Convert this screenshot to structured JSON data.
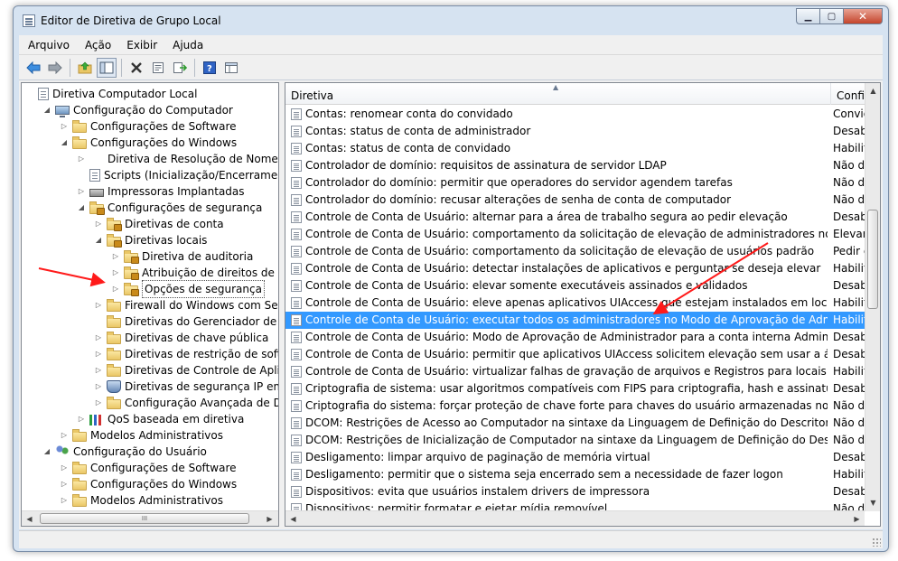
{
  "window": {
    "title": "Editor de Diretiva de Grupo Local",
    "controls": {
      "minimize": "▁",
      "maximize": "▢",
      "close": "✕"
    }
  },
  "menu": [
    "Arquivo",
    "Ação",
    "Exibir",
    "Ajuda"
  ],
  "tree": {
    "items": [
      {
        "label": "Diretiva Computador Local",
        "icon": "document-icon",
        "level": 0,
        "twisty": ""
      },
      {
        "label": "Configuração do Computador",
        "icon": "computer-icon",
        "level": 1,
        "twisty": "◢"
      },
      {
        "label": "Configurações de Software",
        "icon": "folder-icon",
        "level": 2,
        "twisty": "▷"
      },
      {
        "label": "Configurações do Windows",
        "icon": "folder-icon",
        "level": 2,
        "twisty": "◢"
      },
      {
        "label": "Diretiva de Resolução de Nome",
        "icon": "none",
        "level": 3,
        "twisty": "▷"
      },
      {
        "label": "Scripts (Inicialização/Encerramento)",
        "icon": "document-icon",
        "level": 3,
        "twisty": ""
      },
      {
        "label": "Impressoras Implantadas",
        "icon": "printer-icon",
        "level": 3,
        "twisty": "▷"
      },
      {
        "label": "Configurações de segurança",
        "icon": "lock-folder-icon",
        "level": 3,
        "twisty": "◢"
      },
      {
        "label": "Diretivas de conta",
        "icon": "lock-folder-icon",
        "level": 4,
        "twisty": "▷"
      },
      {
        "label": "Diretivas locais",
        "icon": "lock-folder-icon",
        "level": 4,
        "twisty": "◢"
      },
      {
        "label": "Diretiva de auditoria",
        "icon": "lock-folder-icon",
        "level": 5,
        "twisty": "▷"
      },
      {
        "label": "Atribuição de direitos de usuário",
        "icon": "lock-folder-icon",
        "level": 5,
        "twisty": "▷"
      },
      {
        "label": "Opções de segurança",
        "icon": "lock-folder-icon",
        "level": 5,
        "twisty": "▷",
        "selected": true
      },
      {
        "label": "Firewall do Windows com Segurança Avançada",
        "icon": "folder-icon",
        "level": 4,
        "twisty": "▷"
      },
      {
        "label": "Diretivas do Gerenciador de Listas de Redes",
        "icon": "folder-icon",
        "level": 4,
        "twisty": ""
      },
      {
        "label": "Diretivas de chave pública",
        "icon": "folder-icon",
        "level": 4,
        "twisty": "▷"
      },
      {
        "label": "Diretivas de restrição de software",
        "icon": "folder-icon",
        "level": 4,
        "twisty": "▷"
      },
      {
        "label": "Diretivas de Controle de Aplicativos",
        "icon": "folder-icon",
        "level": 4,
        "twisty": "▷"
      },
      {
        "label": "Diretivas de segurança IP em Computador Local",
        "icon": "shield-computer-icon",
        "level": 4,
        "twisty": "▷"
      },
      {
        "label": "Configuração Avançada de Diretiva de Auditoria",
        "icon": "folder-icon",
        "level": 4,
        "twisty": "▷"
      },
      {
        "label": "QoS baseada em diretiva",
        "icon": "qos-chart-icon",
        "level": 3,
        "twisty": "▷"
      },
      {
        "label": "Modelos Administrativos",
        "icon": "folder-icon",
        "level": 2,
        "twisty": "▷"
      },
      {
        "label": "Configuração do Usuário",
        "icon": "users-icon",
        "level": 1,
        "twisty": "◢"
      },
      {
        "label": "Configurações de Software",
        "icon": "folder-icon",
        "level": 2,
        "twisty": "▷"
      },
      {
        "label": "Configurações do Windows",
        "icon": "folder-icon",
        "level": 2,
        "twisty": "▷"
      },
      {
        "label": "Modelos Administrativos",
        "icon": "folder-icon",
        "level": 2,
        "twisty": "▷"
      }
    ],
    "hscroll_thumb_grip": "III"
  },
  "list": {
    "columns": [
      "Diretiva",
      "Config"
    ],
    "rows": [
      {
        "name": "Contas: renomear conta do convidado",
        "value": "Convid"
      },
      {
        "name": "Contas: status de conta de administrador",
        "value": "Desabil"
      },
      {
        "name": "Contas: status de conta de convidado",
        "value": "Habilita"
      },
      {
        "name": "Controlador de domínio: requisitos de assinatura de servidor LDAP",
        "value": "Não de"
      },
      {
        "name": "Controlador do domínio: permitir que operadores do servidor agendem tarefas",
        "value": "Não de"
      },
      {
        "name": "Controlador do domínio: recusar alterações de senha de conta de computador",
        "value": "Não de"
      },
      {
        "name": "Controle de Conta de Usuário: alternar para a área de trabalho segura ao pedir elevação",
        "value": "Desabil"
      },
      {
        "name": "Controle de Conta de Usuário: comportamento da solicitação de elevação de administradores no Modo de ...",
        "value": "Elevar s"
      },
      {
        "name": "Controle de Conta de Usuário: comportamento da solicitação de elevação de usuários padrão",
        "value": "Pedir c"
      },
      {
        "name": "Controle de Conta de Usuário: detectar instalações de aplicativos e perguntar se deseja elevar",
        "value": "Habilita"
      },
      {
        "name": "Controle de Conta de Usuário: elevar somente executáveis assinados e validados",
        "value": "Desabil"
      },
      {
        "name": "Controle de Conta de Usuário: eleve apenas aplicativos UIAccess que estejam instalados em locais seguros",
        "value": "Habilita"
      },
      {
        "name": "Controle de Conta de Usuário: executar todos os administradores no Modo de Aprovação de Administrador",
        "value": "Habilita",
        "selected": true
      },
      {
        "name": "Controle de Conta de Usuário: Modo de Aprovação de Administrador para a conta interna Administrador",
        "value": "Desabil"
      },
      {
        "name": "Controle de Conta de Usuário: permitir que aplicativos UIAccess solicitem elevação sem usar a área de trabal...",
        "value": "Desabil"
      },
      {
        "name": "Controle de Conta de Usuário: virtualizar falhas de gravação de arquivos e Registros para locais por usuário",
        "value": "Habilita"
      },
      {
        "name": "Criptografia de sistema: usar algoritmos compatíveis com FIPS para criptografia, hash e assinatura",
        "value": "Desabil"
      },
      {
        "name": "Criptografia do sistema: forçar proteção de chave forte para chaves do usuário armazenadas no computador",
        "value": "Não de"
      },
      {
        "name": "DCOM: Restrições de Acesso ao Computador na sintaxe da Linguagem de Definição do Descritor de Segura...",
        "value": "Não de"
      },
      {
        "name": "DCOM: Restrições de Inicialização de Computador na sintaxe da Linguagem de Definição do Descritor de Se...",
        "value": "Não de"
      },
      {
        "name": "Desligamento: limpar arquivo de paginação de memória virtual",
        "value": "Desabil"
      },
      {
        "name": "Desligamento: permitir que o sistema seja encerrado sem a necessidade de fazer logon",
        "value": "Habilita"
      },
      {
        "name": "Dispositivos: evita que usuários instalem drivers de impressora",
        "value": "Desabil"
      },
      {
        "name": "Dispositivos: permitir formatar e ejetar mídia removível",
        "value": "Não de"
      }
    ]
  },
  "toolbar": {
    "icons": [
      "back-arrow-icon",
      "forward-arrow-icon",
      "up-folder-icon",
      "show-hide-tree-icon",
      "delete-icon",
      "properties-icon",
      "export-list-icon",
      "help-icon",
      "extended-view-icon"
    ]
  },
  "annotation_color": "#ff1a1a",
  "selection_color": "#3399ff"
}
